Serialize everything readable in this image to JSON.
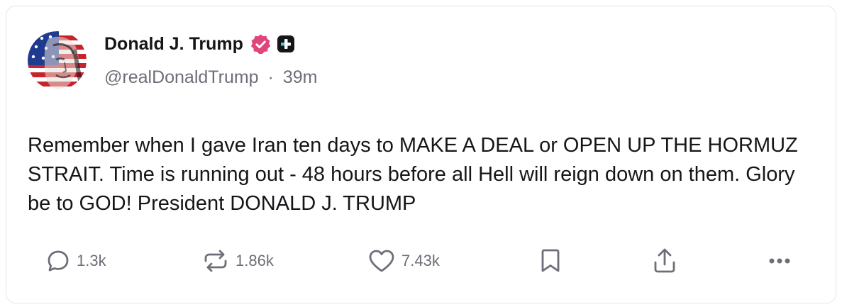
{
  "post": {
    "author": {
      "display_name": "Donald J. Trump",
      "handle": "@realDonaldTrump",
      "separator": "·",
      "time_ago": "39m",
      "verified_color": "#e0457b"
    },
    "text": "Remember when I gave Iran ten days to MAKE A DEAL or OPEN UP THE HORMUZ STRAIT. Time is running out - 48 hours before all Hell will reign down on them. Glory be to GOD! President DONALD J. TRUMP",
    "actions": {
      "replies": {
        "icon": "reply-icon",
        "count": "1.3k"
      },
      "reposts": {
        "icon": "repost-icon",
        "count": "1.86k"
      },
      "likes": {
        "icon": "heart-icon",
        "count": "7.43k"
      },
      "bookmark": {
        "icon": "bookmark-icon"
      },
      "share": {
        "icon": "share-icon"
      },
      "more": {
        "icon": "more-icon"
      }
    }
  },
  "colors": {
    "text_primary": "#16161a",
    "text_secondary": "#6e6e78",
    "verified_badge": "#e0457b",
    "plus_badge": "#16161a"
  }
}
